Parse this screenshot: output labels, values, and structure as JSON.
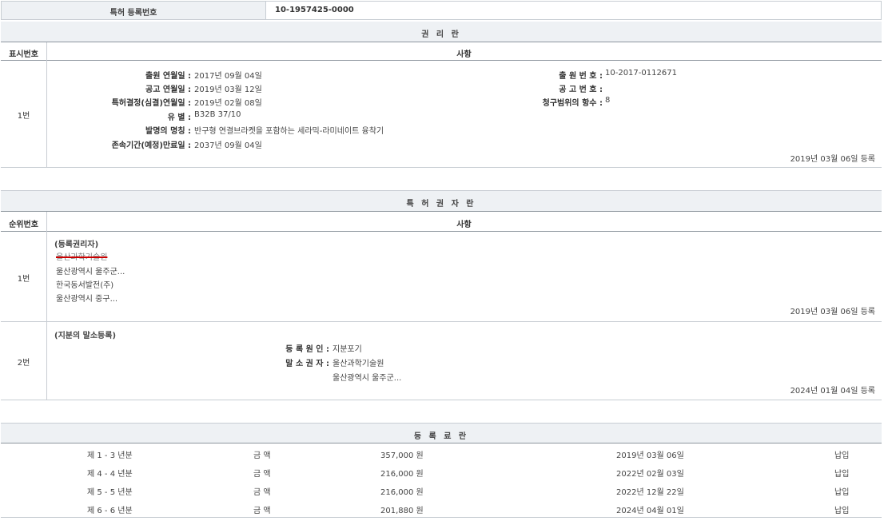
{
  "top": {
    "label": "특허 등록번호",
    "value": "10-1957425-0000"
  },
  "rights": {
    "title": "권 리 란",
    "col_no": "표시번호",
    "col_item": "사항",
    "row_no": "1번",
    "fields_left": [
      {
        "label": "출원 연월일 :",
        "value": "2017년 09월 04일"
      },
      {
        "label": "공고 연월일 :",
        "value": "2019년 03월 12일"
      },
      {
        "label": "특허결정(심결)연월일 :",
        "value": "2019년 02월 08일"
      },
      {
        "label": "유 별 :",
        "value": "B32B 37/10"
      },
      {
        "label": "발명의 명칭 :",
        "value": "반구형 연결브라켓을 포함하는 세라믹-라미네이트 융착기"
      },
      {
        "label": "존속기간(예정)만료일 :",
        "value": "2037년 09월 04일"
      }
    ],
    "fields_right": [
      {
        "label": "출 원 번 호 :",
        "value": "10-2017-0112671"
      },
      {
        "label": "공 고 번 호 :",
        "value": ""
      },
      {
        "label": "청구범위의 항수 :",
        "value": "8"
      }
    ],
    "reg_date": "2019년 03월 06일 등록"
  },
  "holders": {
    "title": "특 허 권 자 란",
    "col_no": "순위번호",
    "col_item": "사항",
    "rows": [
      {
        "no": "1번",
        "heading": "(등록권리자)",
        "struck": "울산과학기술원",
        "lines": [
          "울산광역시 울주군...",
          "한국동서발전(주)",
          "울산광역시 중구..."
        ],
        "date": "2019년 03월 06일 등록"
      },
      {
        "no": "2번",
        "heading": "(지분의 말소등록)",
        "reason_label": "등 록 원 인 :",
        "reason_value": "지분포기",
        "erased_label": "말 소 권 자 :",
        "erased_value": "울산과학기술원",
        "erased_addr": "울산광역시 울주군...",
        "date": "2024년 01월 04일 등록"
      }
    ]
  },
  "fees": {
    "title": "등 록 료 란",
    "rows": [
      {
        "period": "제 1 - 3 년분",
        "label": "금 액",
        "amount": "357,000 원",
        "date": "2019년 03월 06일",
        "status": "납입"
      },
      {
        "period": "제 4 - 4 년분",
        "label": "금 액",
        "amount": "216,000 원",
        "date": "2022년 02월 03일",
        "status": "납입"
      },
      {
        "period": "제 5 - 5 년분",
        "label": "금 액",
        "amount": "216,000 원",
        "date": "2022년 12월 22일",
        "status": "납입"
      },
      {
        "period": "제 6 - 6 년분",
        "label": "금 액",
        "amount": "201,880 원",
        "date": "2024년 04월 01일",
        "status": "납입"
      }
    ]
  }
}
